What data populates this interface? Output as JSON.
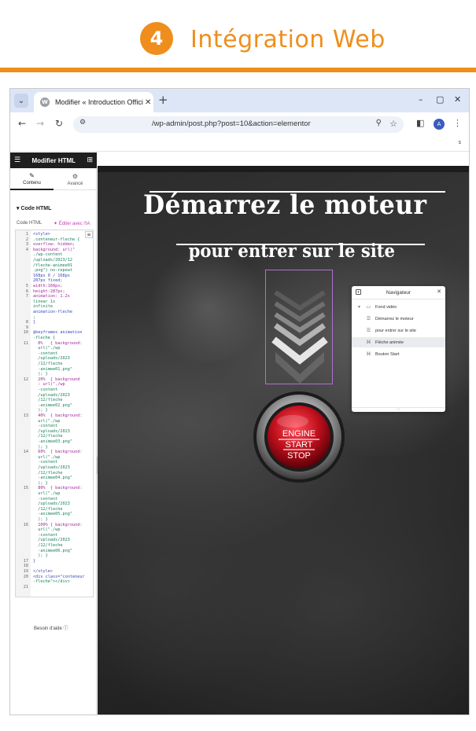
{
  "header": {
    "step_number": "4",
    "title": "Intégration Web",
    "accent": "#ef8e1c"
  },
  "browser": {
    "tab_title": "Modifier « Introduction Officin",
    "tab_favicon": "W",
    "url": "/wp-admin/post.php?post=10&action=elementor",
    "avatar_initial": "A",
    "infobar_text": "s"
  },
  "panel": {
    "title": "Modifier HTML",
    "tabs": [
      {
        "label": "Contenu",
        "icon": "pencil-icon"
      },
      {
        "label": "Avancé",
        "icon": "gear-icon"
      }
    ],
    "section_title": "Code HTML",
    "field_label": "Code HTML",
    "ai_button": "✦ Éditer avec l'IA",
    "help_text": "Besoin d'aide",
    "code_lines": [
      {
        "n": "1",
        "t": "<style>"
      },
      {
        "n": "2",
        "t": ".conteneur-fleche {"
      },
      {
        "n": "3",
        "t": "overflow: hidden;"
      },
      {
        "n": "4",
        "t": "background: url(\""
      },
      {
        "n": "",
        "t": "./wp-content"
      },
      {
        "n": "",
        "t": "/uploads/2023/12"
      },
      {
        "n": "",
        "t": "/fleche-animee01"
      },
      {
        "n": "",
        "t": ".png\") no-repeat"
      },
      {
        "n": "",
        "t": "168px 0 / 168px"
      },
      {
        "n": "",
        "t": "287px fixed;"
      },
      {
        "n": "5",
        "t": "width:168px;"
      },
      {
        "n": "6",
        "t": "height:287px;"
      },
      {
        "n": "7",
        "t": "animation: 1.2s"
      },
      {
        "n": "",
        "t": "linear 1s"
      },
      {
        "n": "",
        "t": "infinite"
      },
      {
        "n": "",
        "t": "animation-fleche"
      },
      {
        "n": "",
        "t": ";"
      },
      {
        "n": "8",
        "t": "}"
      },
      {
        "n": "9",
        "t": ""
      },
      {
        "n": "10",
        "t": "@keyframes animation"
      },
      {
        "n": "",
        "t": "-fleche {"
      },
      {
        "n": "11",
        "t": "  0%   { background:"
      },
      {
        "n": "",
        "t": "  url(\"./wp"
      },
      {
        "n": "",
        "t": "  -content"
      },
      {
        "n": "",
        "t": "  /uploads/2023"
      },
      {
        "n": "",
        "t": "  /12/fleche"
      },
      {
        "n": "",
        "t": "  -animee01.png\""
      },
      {
        "n": "",
        "t": "  ); }"
      },
      {
        "n": "12",
        "t": "  20%  { background"
      },
      {
        "n": "",
        "t": "  : url(\"./wp"
      },
      {
        "n": "",
        "t": "  -content"
      },
      {
        "n": "",
        "t": "  /uploads/2023"
      },
      {
        "n": "",
        "t": "  /12/fleche"
      },
      {
        "n": "",
        "t": "  -animee02.png\""
      },
      {
        "n": "",
        "t": "  ); }"
      },
      {
        "n": "13",
        "t": "  40%  { background:"
      },
      {
        "n": "",
        "t": "  url(\"./wp"
      },
      {
        "n": "",
        "t": "  -content"
      },
      {
        "n": "",
        "t": "  /uploads/2023"
      },
      {
        "n": "",
        "t": "  /12/fleche"
      },
      {
        "n": "",
        "t": "  -animee03.png\""
      },
      {
        "n": "",
        "t": "  ); }"
      },
      {
        "n": "14",
        "t": "  60%  { background:"
      },
      {
        "n": "",
        "t": "  url(\"./wp"
      },
      {
        "n": "",
        "t": "  -content"
      },
      {
        "n": "",
        "t": "  /uploads/2023"
      },
      {
        "n": "",
        "t": "  /12/fleche"
      },
      {
        "n": "",
        "t": "  -animee04.png\""
      },
      {
        "n": "",
        "t": "  ); }"
      },
      {
        "n": "15",
        "t": "  80%  { background:"
      },
      {
        "n": "",
        "t": "  url(\"./wp"
      },
      {
        "n": "",
        "t": "  -content"
      },
      {
        "n": "",
        "t": "  /uploads/2023"
      },
      {
        "n": "",
        "t": "  /12/fleche"
      },
      {
        "n": "",
        "t": "  -animee05.png\""
      },
      {
        "n": "",
        "t": "  ); }"
      },
      {
        "n": "16",
        "t": "  100% { background:"
      },
      {
        "n": "",
        "t": "  url(\"./wp"
      },
      {
        "n": "",
        "t": "  -content"
      },
      {
        "n": "",
        "t": "  /uploads/2023"
      },
      {
        "n": "",
        "t": "  /12/fleche"
      },
      {
        "n": "",
        "t": "  -animee06.png\""
      },
      {
        "n": "",
        "t": "  ); }"
      },
      {
        "n": "17",
        "t": "}"
      },
      {
        "n": "18",
        "t": ""
      },
      {
        "n": "19",
        "t": "</style>"
      },
      {
        "n": "20",
        "t": "<div class=\"conteneur"
      },
      {
        "n": "",
        "t": "-fleche\"></div>"
      },
      {
        "n": "21",
        "t": ""
      }
    ]
  },
  "canvas": {
    "headline": "Démarrez le moteur",
    "subline": "pour entrer sur le site",
    "engine_button": {
      "line1": "ENGINE",
      "line2": "START",
      "line3": "STOP",
      "color": "#c0101c"
    }
  },
  "navigator": {
    "title": "Navigateur",
    "items": [
      {
        "label": "Fond vidéo",
        "icon": "container-icon",
        "level": 0,
        "selected": false
      },
      {
        "label": "Démarrez le moteur",
        "icon": "heading-icon",
        "level": 1,
        "selected": false
      },
      {
        "label": "pour entrer sur le site",
        "icon": "heading-icon",
        "level": 1,
        "selected": false
      },
      {
        "label": "Flèche animée",
        "icon": "html-icon",
        "level": 1,
        "selected": true
      },
      {
        "label": "Bouton Start",
        "icon": "html-icon",
        "level": 1,
        "selected": false
      }
    ]
  }
}
